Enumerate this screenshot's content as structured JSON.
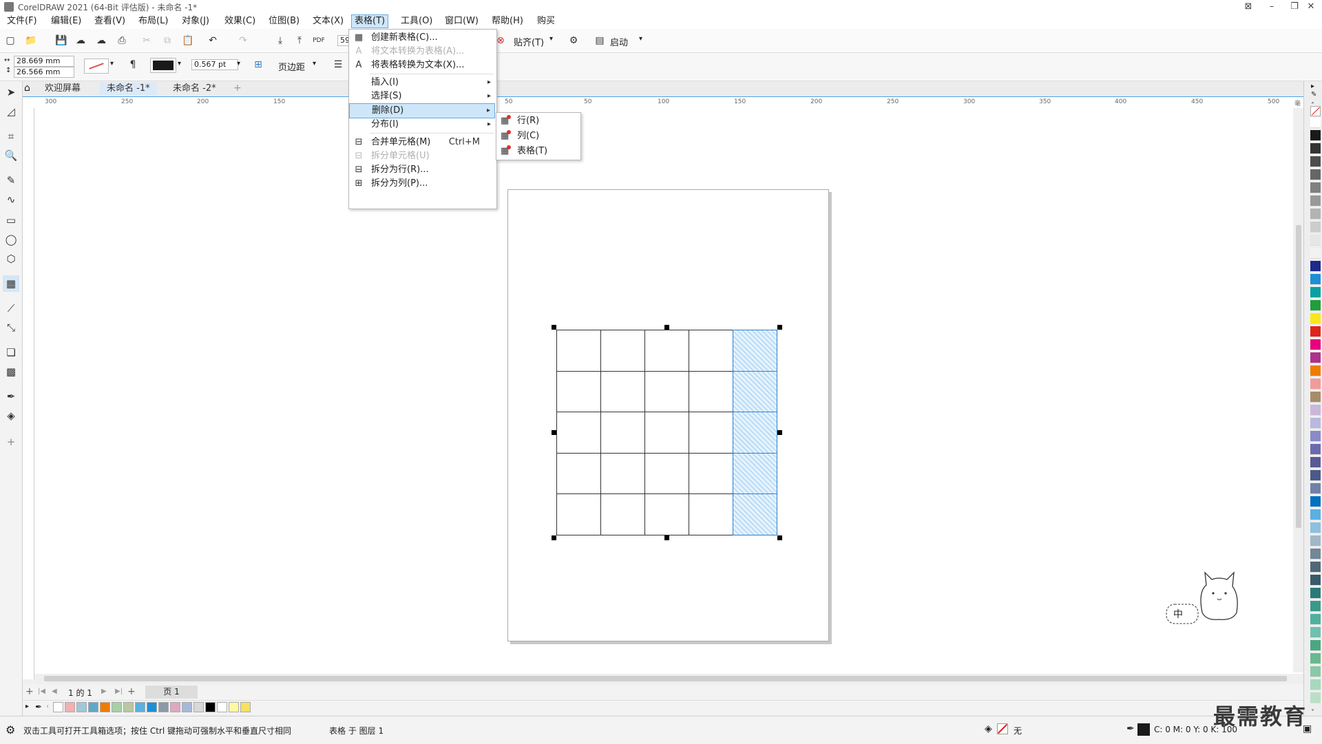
{
  "window": {
    "title": "CorelDRAW 2021 (64-Bit 评估版) - 未命名 -1*",
    "controls": [
      "⊠",
      "–",
      "❐",
      "✕"
    ]
  },
  "menubar": {
    "items": [
      "文件(F)",
      "编辑(E)",
      "查看(V)",
      "布局(L)",
      "对象(J)",
      "效果(C)",
      "位图(B)",
      "文本(X)",
      "表格(T)",
      "工具(O)",
      "窗口(W)",
      "帮助(H)",
      "购买"
    ],
    "active_index": 8
  },
  "toolbar": {
    "zoom_value": "59",
    "snap_label": "贴齐(T)",
    "launch_label": "启动"
  },
  "propertybar": {
    "width": "28.669 mm",
    "height": "26.566 mm",
    "outline_width": "0.567 pt",
    "page_margin_label": "页边距"
  },
  "tabs": [
    "欢迎屏幕",
    "未命名 -1*",
    "未命名 -2*"
  ],
  "ruler": {
    "h_labels": [
      "300",
      "250",
      "200",
      "150",
      "50",
      "0",
      "50",
      "100",
      "150",
      "200",
      "250",
      "300",
      "350",
      "400",
      "450",
      "500"
    ],
    "units": "毫米"
  },
  "table_menu": {
    "items": [
      {
        "label": "创建新表格(C)...",
        "icon": "table-new-icon",
        "disabled": false
      },
      {
        "label": "将文本转换为表格(A)...",
        "icon": "text-to-table-icon",
        "disabled": true
      },
      {
        "label": "将表格转换为文本(X)...",
        "icon": "table-to-text-icon",
        "disabled": false
      },
      {
        "label": "插入(I)",
        "submenu": true,
        "disabled": false
      },
      {
        "label": "选择(S)",
        "submenu": true,
        "disabled": false
      },
      {
        "label": "删除(D)",
        "submenu": true,
        "disabled": false,
        "hover": true
      },
      {
        "label": "分布(I)",
        "submenu": true,
        "disabled": false
      },
      {
        "label": "合并单元格(M)",
        "shortcut": "Ctrl+M",
        "icon": "merge-cells-icon",
        "disabled": false
      },
      {
        "label": "拆分单元格(U)",
        "icon": "split-cells-icon",
        "disabled": true
      },
      {
        "label": "拆分为行(R)...",
        "icon": "split-rows-icon",
        "disabled": false
      },
      {
        "label": "拆分为列(P)...",
        "icon": "split-columns-icon",
        "disabled": false
      }
    ]
  },
  "delete_submenu": {
    "items": [
      "行(R)",
      "列(C)",
      "表格(T)"
    ]
  },
  "pagenav": {
    "page_count": "1 的 1",
    "page_tab": "页 1"
  },
  "status": {
    "hint": "双击工具可打开工具箱选项；按住 Ctrl 键拖动可强制水平和垂直尺寸相同",
    "layer_info": "表格 于 图层 1",
    "fill_label": "无",
    "color_readout": "C: 0 M: 0 Y: 0 K: 100"
  },
  "table": {
    "rows": 5,
    "cols": 5,
    "selected_col": 4
  },
  "mascot_text": "中",
  "watermark": "最需教育",
  "colors": {
    "accent": "#4aa3e8",
    "selection": "#b9dcf7",
    "right_palette": [
      "#ffffff",
      "#1a1a1a",
      "#333333",
      "#4d4d4d",
      "#666666",
      "#808080",
      "#999999",
      "#b3b3b3",
      "#cccccc",
      "#e6e6e6",
      "#f2f2f2",
      "#1b2a8c",
      "#1d8fd6",
      "#0aa0a0",
      "#1f9e3c",
      "#f8e71c",
      "#e2231a",
      "#e6007e",
      "#b0308a",
      "#ef7c00",
      "#f29b9b",
      "#a88c6a",
      "#c9b8d8",
      "#b8b8e0",
      "#8a8ac8",
      "#6a6ab0",
      "#5a5a96",
      "#4a5a8a",
      "#7080a8",
      "#0070c0",
      "#5ab0e0",
      "#8cc0e0",
      "#a0b8c8",
      "#708898",
      "#506878",
      "#3a5a6a",
      "#2a7a7a",
      "#3a9a8a",
      "#50b0a0",
      "#70c0b0",
      "#4aa880",
      "#6ab890",
      "#8ac8a8",
      "#a8d8c0",
      "#b8e0c8"
    ],
    "bottom_palette": [
      "#ffffff",
      "#f2b0b0",
      "#a0c8d8",
      "#60a8c8",
      "#ef7c00",
      "#a8d0a8",
      "#b8c8a0",
      "#5ab0e0",
      "#1d8fd6",
      "#8a9aa8",
      "#e0a8c0",
      "#a8b8d8",
      "#d8d8d8",
      "#000000",
      "#ffffff",
      "#fff8a0",
      "#f8e060"
    ]
  }
}
